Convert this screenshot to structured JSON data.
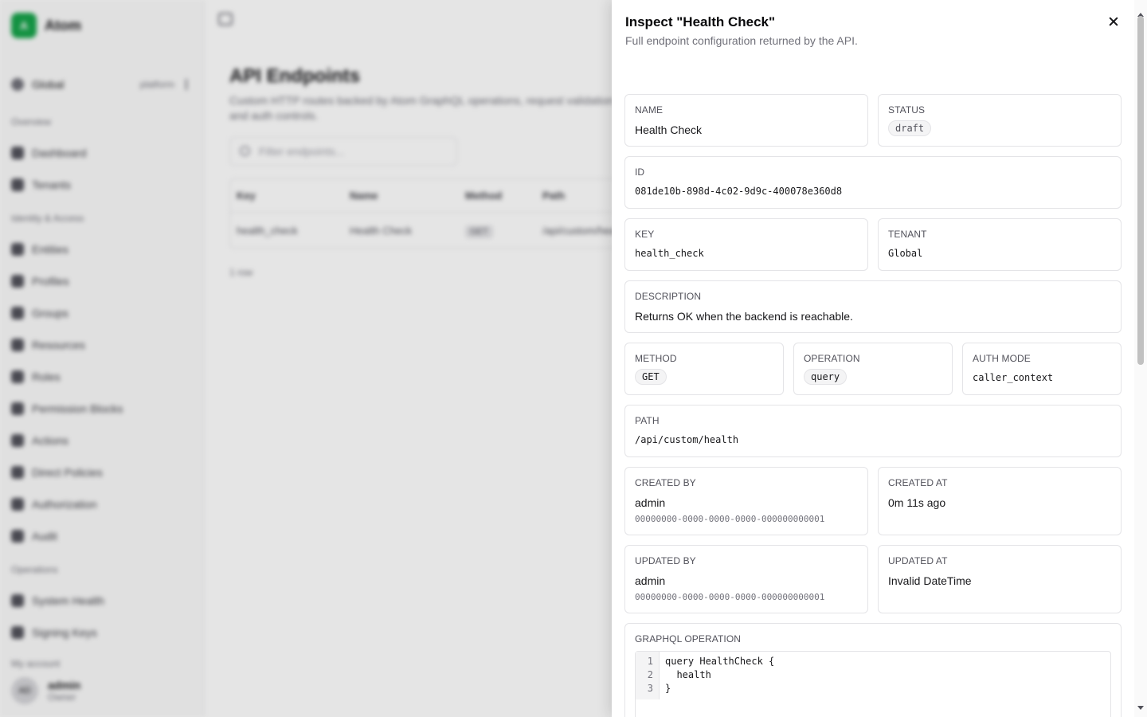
{
  "sidebar": {
    "brand": "Atom",
    "brand_logo": "A",
    "tenant_switch": {
      "label": "Global",
      "scope": "platform"
    },
    "sections": {
      "overview": {
        "label": "Overview",
        "items": [
          "Dashboard",
          "Tenants"
        ]
      },
      "identity": {
        "label": "Identity & Access",
        "items": [
          "Entities",
          "Profiles",
          "Groups",
          "Resources",
          "Roles",
          "Permission Blocks",
          "Actions",
          "Direct Policies",
          "Authorization",
          "Audit"
        ]
      },
      "operations": {
        "label": "Operations",
        "items": [
          "System Health",
          "Signing Keys"
        ]
      }
    },
    "account": {
      "section_label": "My account",
      "initials": "AD",
      "name": "admin",
      "role": "Owner"
    }
  },
  "main": {
    "title": "API Endpoints",
    "description": "Custom HTTP routes backed by Atom GraphQL operations, request validation, and auth controls.",
    "filter_placeholder": "Filter endpoints...",
    "table": {
      "headers": [
        "Key",
        "Name",
        "Method",
        "Path"
      ],
      "rows": [
        {
          "key": "health_check",
          "name": "Health Check",
          "method": "GET",
          "path": "/api/custom/health"
        }
      ]
    },
    "row_count": "1 row"
  },
  "panel": {
    "title": "Inspect \"Health Check\"",
    "subtitle": "Full endpoint configuration returned by the API.",
    "fields": {
      "name": {
        "label": "Name",
        "value": "Health Check"
      },
      "status": {
        "label": "Status",
        "value": "draft"
      },
      "id": {
        "label": "ID",
        "value": "081de10b-898d-4c02-9d9c-400078e360d8"
      },
      "key": {
        "label": "Key",
        "value": "health_check"
      },
      "tenant": {
        "label": "Tenant",
        "value": "Global"
      },
      "description": {
        "label": "Description",
        "value": "Returns OK when the backend is reachable."
      },
      "method": {
        "label": "Method",
        "value": "GET"
      },
      "operation": {
        "label": "Operation",
        "value": "query"
      },
      "auth_mode": {
        "label": "Auth Mode",
        "value": "caller_context"
      },
      "path": {
        "label": "Path",
        "value": "/api/custom/health"
      },
      "created_by": {
        "label": "Created By",
        "value": "admin",
        "id": "00000000-0000-0000-0000-000000000001"
      },
      "created_at": {
        "label": "Created At",
        "value": "0m 11s ago"
      },
      "updated_by": {
        "label": "Updated By",
        "value": "admin",
        "id": "00000000-0000-0000-0000-000000000001"
      },
      "updated_at": {
        "label": "Updated At",
        "value": "Invalid DateTime"
      }
    },
    "graphql": {
      "label": "GraphQL Operation",
      "lines": [
        {
          "n": "1",
          "text": "query HealthCheck {"
        },
        {
          "n": "2",
          "text": "  health"
        },
        {
          "n": "3",
          "text": "}"
        }
      ]
    }
  },
  "colors": {
    "brand": "#16a34a",
    "overlay": "rgba(0,0,0,0.10)",
    "border": "#e4e4e7"
  }
}
